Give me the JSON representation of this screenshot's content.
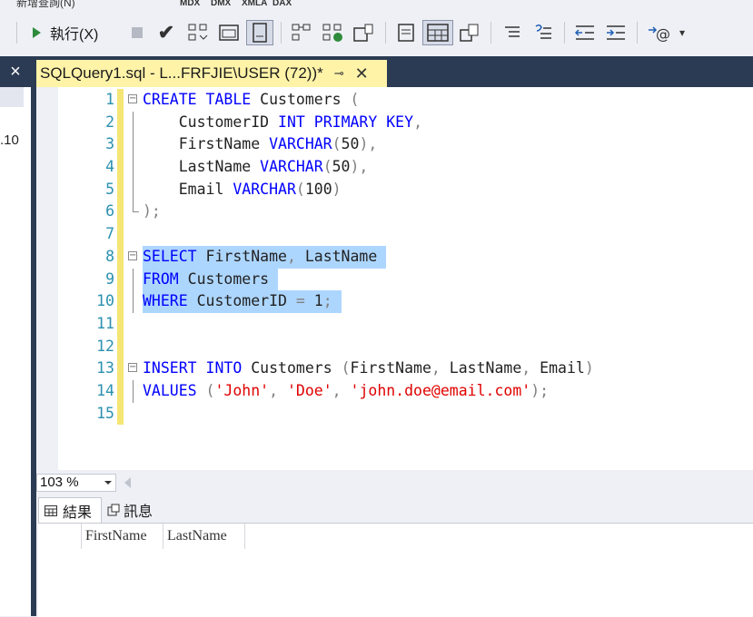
{
  "top_strip": {
    "menu_fragment": "新增查詢(N)",
    "mdx": "MDX",
    "dmx": "DMX",
    "xmla": "XMLA",
    "dax": "DAX"
  },
  "toolbar": {
    "run_label": "執行(X)"
  },
  "left_panel": {
    "close": "×",
    "fragment": ".10"
  },
  "tab": {
    "title": "SQLQuery1.sql - L...FRFJIE\\USER (72))*",
    "pin": "⊸",
    "close": "✕"
  },
  "editor": {
    "lines": [
      {
        "n": "1",
        "tokens": [
          [
            "kw",
            "CREATE"
          ],
          [
            "pl",
            " "
          ],
          [
            "kw",
            "TABLE"
          ],
          [
            "pl",
            " Customers "
          ],
          [
            "op",
            "("
          ]
        ]
      },
      {
        "n": "2",
        "tokens": [
          [
            "pl",
            "    CustomerID "
          ],
          [
            "kw",
            "INT"
          ],
          [
            "pl",
            " "
          ],
          [
            "kw",
            "PRIMARY"
          ],
          [
            "pl",
            " "
          ],
          [
            "kw",
            "KEY"
          ],
          [
            "op",
            ","
          ]
        ]
      },
      {
        "n": "3",
        "tokens": [
          [
            "pl",
            "    FirstName "
          ],
          [
            "kw",
            "VARCHAR"
          ],
          [
            "op",
            "("
          ],
          [
            "pl",
            "50"
          ],
          [
            "op",
            "),"
          ]
        ]
      },
      {
        "n": "4",
        "tokens": [
          [
            "pl",
            "    LastName "
          ],
          [
            "kw",
            "VARCHAR"
          ],
          [
            "op",
            "("
          ],
          [
            "pl",
            "50"
          ],
          [
            "op",
            "),"
          ]
        ]
      },
      {
        "n": "5",
        "tokens": [
          [
            "pl",
            "    Email "
          ],
          [
            "kw",
            "VARCHAR"
          ],
          [
            "op",
            "("
          ],
          [
            "pl",
            "100"
          ],
          [
            "op",
            ")"
          ]
        ]
      },
      {
        "n": "6",
        "tokens": [
          [
            "op",
            ");"
          ]
        ]
      },
      {
        "n": "7",
        "tokens": []
      },
      {
        "n": "8",
        "tokens": [
          [
            "kw",
            "SELECT"
          ],
          [
            "pl",
            " FirstName"
          ],
          [
            "op",
            ","
          ],
          [
            "pl",
            " LastName "
          ]
        ]
      },
      {
        "n": "9",
        "tokens": [
          [
            "kw",
            "FROM"
          ],
          [
            "pl",
            " Customers "
          ]
        ]
      },
      {
        "n": "10",
        "tokens": [
          [
            "kw",
            "WHERE"
          ],
          [
            "pl",
            " CustomerID "
          ],
          [
            "op",
            "="
          ],
          [
            "pl",
            " 1"
          ],
          [
            "op",
            ";"
          ]
        ]
      },
      {
        "n": "11",
        "tokens": []
      },
      {
        "n": "12",
        "tokens": []
      },
      {
        "n": "13",
        "tokens": [
          [
            "kw",
            "INSERT"
          ],
          [
            "pl",
            " "
          ],
          [
            "kw",
            "INTO"
          ],
          [
            "pl",
            " Customers "
          ],
          [
            "op",
            "("
          ],
          [
            "pl",
            "FirstName"
          ],
          [
            "op",
            ","
          ],
          [
            "pl",
            " LastName"
          ],
          [
            "op",
            ","
          ],
          [
            "pl",
            " Email"
          ],
          [
            "op",
            ")"
          ]
        ]
      },
      {
        "n": "14",
        "tokens": [
          [
            "kw",
            "VALUES"
          ],
          [
            "pl",
            " "
          ],
          [
            "op",
            "("
          ],
          [
            "st",
            "'John'"
          ],
          [
            "op",
            ","
          ],
          [
            "pl",
            " "
          ],
          [
            "st",
            "'Doe'"
          ],
          [
            "op",
            ","
          ],
          [
            "pl",
            " "
          ],
          [
            "st",
            "'john.doe@email.com'"
          ],
          [
            "op",
            ");"
          ]
        ]
      },
      {
        "n": "15",
        "tokens": []
      }
    ]
  },
  "status": {
    "zoom": "103 %"
  },
  "results": {
    "tab_results": "結果",
    "tab_messages": "訊息",
    "columns": [
      "FirstName",
      "LastName"
    ]
  }
}
